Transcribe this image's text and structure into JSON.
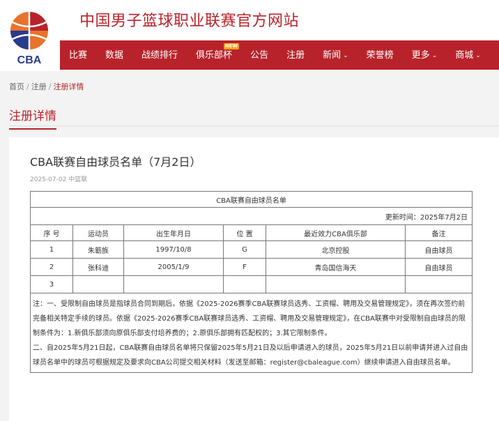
{
  "site": {
    "title": "中国男子篮球职业联赛官方网站",
    "logo_text": "CBA"
  },
  "nav": {
    "items": [
      {
        "label": "比赛",
        "dropdown": false,
        "badge": ""
      },
      {
        "label": "数据",
        "dropdown": false,
        "badge": ""
      },
      {
        "label": "战绩排行",
        "dropdown": false,
        "badge": ""
      },
      {
        "label": "俱乐部杯",
        "dropdown": false,
        "badge": "NEW"
      },
      {
        "label": "公告",
        "dropdown": false,
        "badge": ""
      },
      {
        "label": "注册",
        "dropdown": false,
        "badge": ""
      },
      {
        "label": "新闻",
        "dropdown": true,
        "badge": ""
      },
      {
        "label": "荣誉榜",
        "dropdown": false,
        "badge": ""
      },
      {
        "label": "更多",
        "dropdown": true,
        "badge": ""
      },
      {
        "label": "商城",
        "dropdown": true,
        "badge": ""
      }
    ]
  },
  "breadcrumb": {
    "items": [
      "首页",
      "注册",
      "注册详情"
    ]
  },
  "section": {
    "title": "注册详情"
  },
  "article": {
    "title": "CBA联赛自由球员名单（7月2日）",
    "date": "2025-07-02",
    "source": "中篮联",
    "table": {
      "caption": "CBA联赛自由球员名单",
      "updated": "更新时间：2025年7月2日",
      "headers": [
        "序 号",
        "运动员",
        "出生年月日",
        "位 置",
        "最近效力CBA俱乐部",
        "备注"
      ],
      "rows": [
        [
          "1",
          "朱簕旌",
          "1997/10/8",
          "G",
          "北京控股",
          "自由球员"
        ],
        [
          "2",
          "张科迪",
          "2005/1/9",
          "F",
          "青岛国信海天",
          "自由球员"
        ],
        [
          "3",
          "",
          "",
          "",
          "",
          ""
        ]
      ],
      "notes": [
        "注：一、受限制自由球员是指球员合同到期后，依据《2025-2026赛季CBA联赛球员选秀、工资帽、聘用及交易管理规定》，须在再次签约前完备相关特定手续的球员。依据《2025-2026赛季CBA联赛球员选秀、工资帽、聘用及交易管理规定》，在CBA联赛中对受限制自由球员的限制条件为：1.新俱乐部须向原俱乐部支付培养费的；2.原俱乐部拥有匹配权的；3.其它限制条件。",
        "二、自2025年5月21日起，CBA联赛自由球员名单将只保留2025年5月21日及以后申请进入的球员，2025年5月21日以前申请并进入过自由球员名单中的球员可根据规定及要求向CBA公司提交相关材料（发送至邮箱：register@cbaleague.com）继续申请进入自由球员名单。"
      ]
    }
  },
  "colors": {
    "brand_red": "#b8232b",
    "badge_orange": "#f5a11a",
    "logo_orange": "#e8732c",
    "logo_blue": "#2a3a8c"
  }
}
